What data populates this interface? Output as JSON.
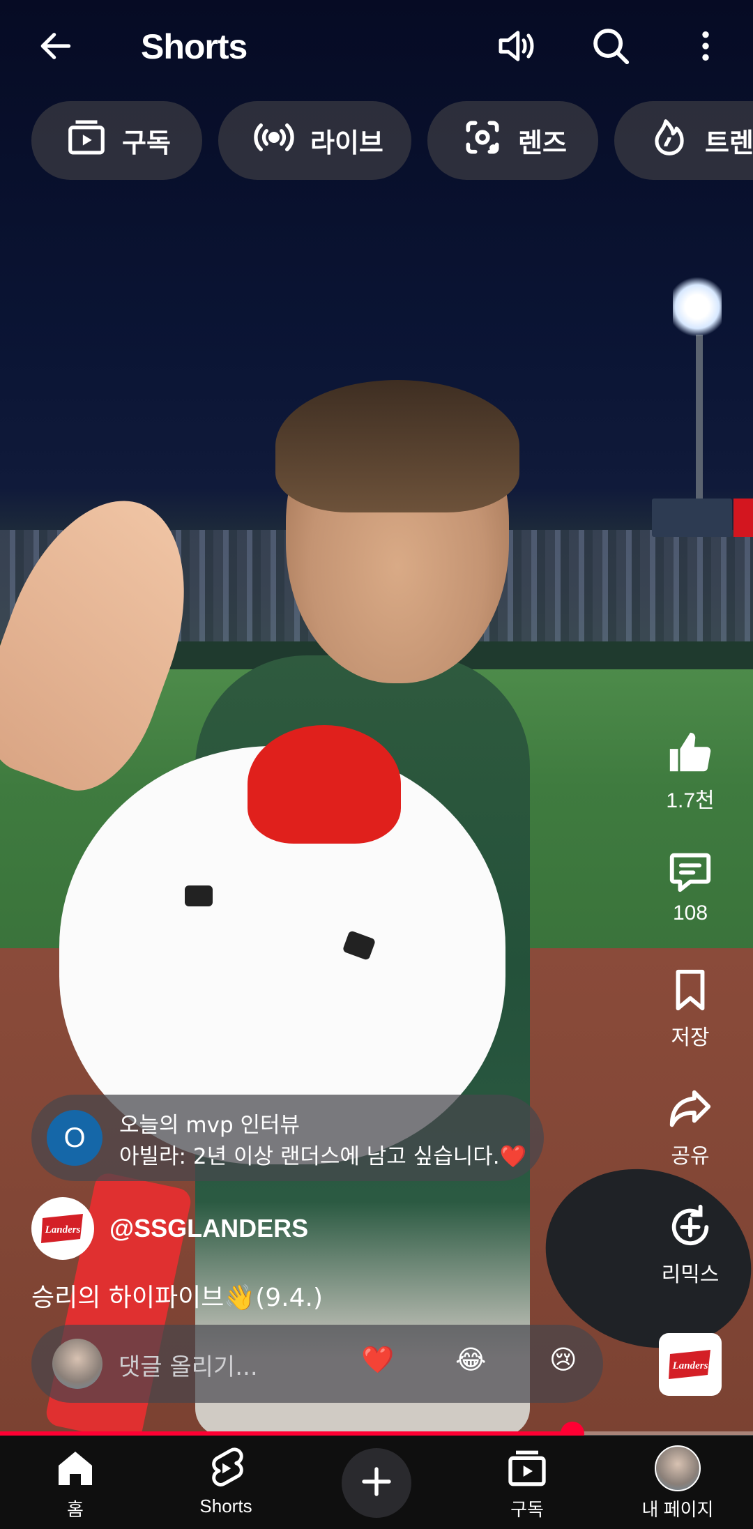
{
  "header": {
    "title": "Shorts",
    "back_icon": "arrow-left-icon",
    "sound_icon": "volume-icon",
    "search_icon": "search-icon",
    "more_icon": "more-vertical-icon"
  },
  "chips": [
    {
      "label": "구독",
      "icon": "subscriptions-icon"
    },
    {
      "label": "라이브",
      "icon": "live-icon"
    },
    {
      "label": "렌즈",
      "icon": "lens-icon"
    },
    {
      "label": "트렌",
      "icon": "trending-icon"
    }
  ],
  "actions": {
    "like": {
      "label": "1.7천",
      "icon": "thumbs-up-icon"
    },
    "comment": {
      "label": "108",
      "icon": "comment-icon"
    },
    "save": {
      "label": "저장",
      "icon": "bookmark-icon"
    },
    "share": {
      "label": "공유",
      "icon": "share-icon"
    },
    "remix": {
      "label": "리믹스",
      "icon": "remix-icon"
    }
  },
  "caption": {
    "avatar_letter": "O",
    "line1": "오늘의 mvp 인터뷰",
    "line2": "아빌라: 2년 이상 랜더스에 남고 싶습니다.❤️"
  },
  "channel": {
    "name": "@SSGLANDERS",
    "logo_text": "Landers"
  },
  "description": "승리의 하이파이브👋(9.4.)",
  "comment_bar": {
    "placeholder": "댓글 올리기...",
    "emojis": [
      "❤️",
      "😂",
      "😢"
    ]
  },
  "progress": {
    "value": 0.76,
    "color": "#ff0033"
  },
  "bottom_nav": [
    {
      "label": "홈",
      "icon": "home-icon"
    },
    {
      "label": "Shorts",
      "icon": "shorts-icon"
    },
    {
      "label": "",
      "icon": "plus-icon"
    },
    {
      "label": "구독",
      "icon": "subscriptions-icon"
    },
    {
      "label": "내 페이지",
      "icon": "avatar"
    }
  ]
}
